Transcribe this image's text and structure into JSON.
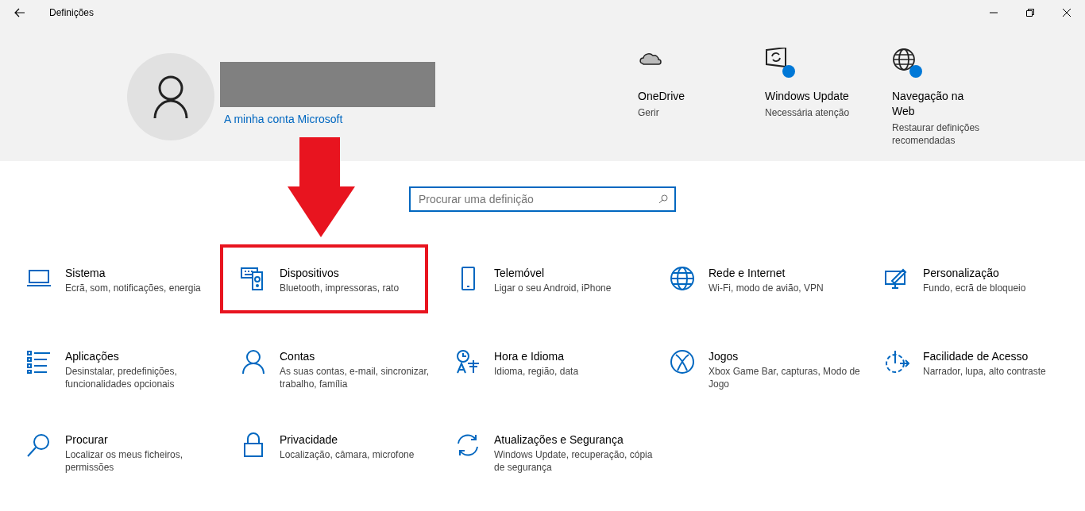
{
  "window": {
    "title": "Definições"
  },
  "account": {
    "link": "A minha conta Microsoft"
  },
  "quick_links": [
    {
      "title": "OneDrive",
      "subtitle": "Gerir",
      "badge": false
    },
    {
      "title": "Windows Update",
      "subtitle": "Necessária atenção",
      "badge": true
    },
    {
      "title": "Navegação na Web",
      "subtitle": "Restaurar definições recomendadas",
      "badge": true
    }
  ],
  "search": {
    "placeholder": "Procurar uma definição"
  },
  "categories": [
    {
      "title": "Sistema",
      "subtitle": "Ecrã, som, notificações, energia",
      "highlighted": false
    },
    {
      "title": "Dispositivos",
      "subtitle": "Bluetooth, impressoras, rato",
      "highlighted": true
    },
    {
      "title": "Telemóvel",
      "subtitle": "Ligar o seu Android, iPhone",
      "highlighted": false
    },
    {
      "title": "Rede e Internet",
      "subtitle": "Wi-Fi, modo de avião, VPN",
      "highlighted": false
    },
    {
      "title": "Personalização",
      "subtitle": "Fundo, ecrã de bloqueio",
      "highlighted": false
    },
    {
      "title": "Aplicações",
      "subtitle": "Desinstalar, predefinições, funcionalidades opcionais",
      "highlighted": false
    },
    {
      "title": "Contas",
      "subtitle": "As suas contas, e-mail, sincronizar, trabalho, família",
      "highlighted": false
    },
    {
      "title": "Hora e Idioma",
      "subtitle": "Idioma, região, data",
      "highlighted": false
    },
    {
      "title": "Jogos",
      "subtitle": "Xbox Game Bar, capturas, Modo de Jogo",
      "highlighted": false
    },
    {
      "title": "Facilidade de Acesso",
      "subtitle": "Narrador, lupa, alto contraste",
      "highlighted": false
    },
    {
      "title": "Procurar",
      "subtitle": "Localizar os meus ficheiros, permissões",
      "highlighted": false
    },
    {
      "title": "Privacidade",
      "subtitle": "Localização, câmara, microfone",
      "highlighted": false
    },
    {
      "title": "Atualizações e Segurança",
      "subtitle": "Windows Update, recuperação, cópia de segurança",
      "highlighted": false
    }
  ]
}
